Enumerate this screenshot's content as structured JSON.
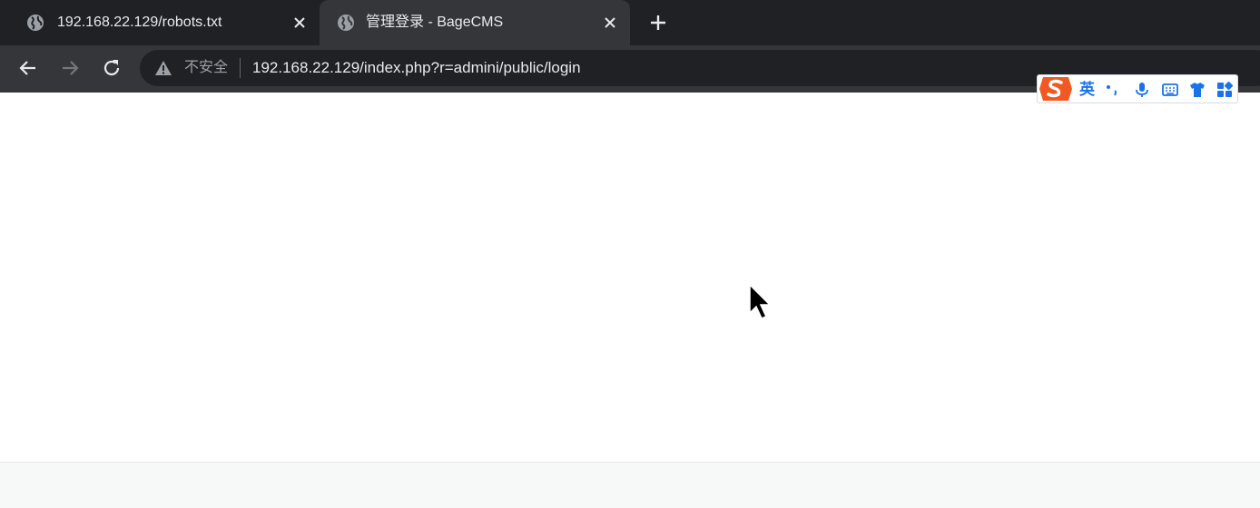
{
  "tabs": [
    {
      "title": "192.168.22.129/robots.txt",
      "active": false
    },
    {
      "title": "管理登录 - BageCMS",
      "active": true
    }
  ],
  "toolbar": {
    "security_label": "不安全",
    "url": "192.168.22.129/index.php?r=admini/public/login"
  },
  "ime": {
    "language": "英"
  },
  "colors": {
    "tabstrip_bg": "#202124",
    "toolbar_bg": "#35363a",
    "omnibox_bg": "#202124",
    "ime_accent": "#1a73e8",
    "ime_logo": "#f05a22"
  }
}
